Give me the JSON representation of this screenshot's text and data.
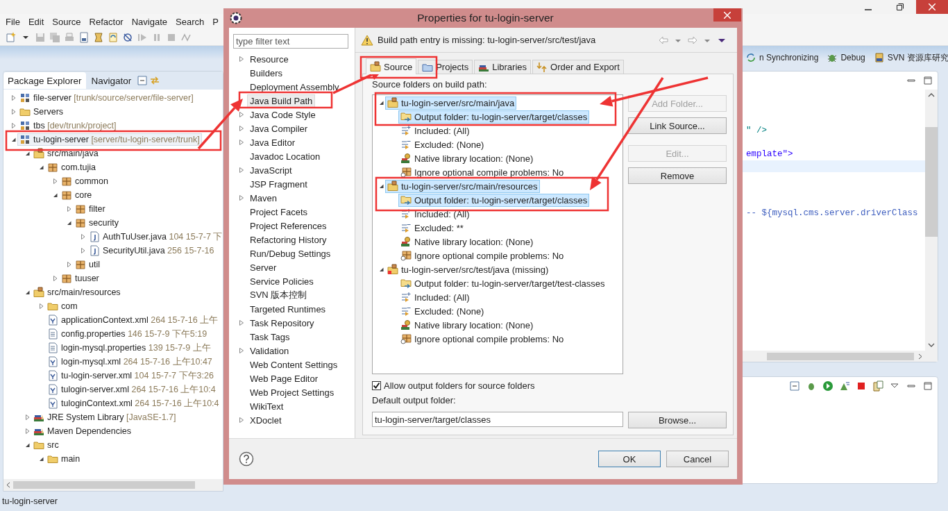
{
  "menu": [
    "File",
    "Edit",
    "Source",
    "Refactor",
    "Navigate",
    "Search",
    "P"
  ],
  "perspectives": [
    {
      "label": "n Synchronizing",
      "kind": "sync"
    },
    {
      "label": "Debug",
      "kind": "debug"
    },
    {
      "label": "SVN 资源库研究",
      "kind": "svn"
    }
  ],
  "views": [
    {
      "label": "Package Explorer",
      "selected": true
    },
    {
      "label": "Navigator",
      "selected": false
    }
  ],
  "package_tree": [
    {
      "label": "file-server",
      "decoration": "[trunk/source/server/file-server]",
      "kind": "project",
      "expanded": false,
      "selected": false
    },
    {
      "label": "Servers",
      "kind": "folder",
      "expanded": false,
      "selected": false
    },
    {
      "label": "tbs",
      "decoration": "[dev/trunk/project]",
      "kind": "project",
      "expanded": false,
      "selected": false
    },
    {
      "label": "tu-login-server",
      "decoration": "[server/tu-login-server/trunk]",
      "kind": "project",
      "expanded": true,
      "selected": true,
      "children": [
        {
          "label": "src/main/java",
          "kind": "source_folder",
          "expanded": true,
          "selected": false,
          "children": [
            {
              "label": "com.tujia",
              "kind": "package",
              "expanded": true,
              "selected": false,
              "children": [
                {
                  "label": "common",
                  "kind": "package",
                  "expanded": false,
                  "selected": false
                },
                {
                  "label": "core",
                  "kind": "package",
                  "expanded": true,
                  "selected": false,
                  "children": [
                    {
                      "label": "filter",
                      "kind": "package",
                      "expanded": false,
                      "selected": false
                    },
                    {
                      "label": "security",
                      "kind": "package",
                      "expanded": true,
                      "selected": false,
                      "children": [
                        {
                          "label": "AuthTuUser.java",
                          "decoration": "104  15-7-7 下",
                          "kind": "java",
                          "expanded": false,
                          "selected": false
                        },
                        {
                          "label": "SecurityUtil.java",
                          "decoration": "256  15-7-16",
                          "kind": "java",
                          "expanded": false,
                          "selected": false
                        }
                      ]
                    },
                    {
                      "label": "util",
                      "kind": "package",
                      "expanded": false,
                      "selected": false
                    }
                  ]
                },
                {
                  "label": "tuuser",
                  "kind": "package",
                  "expanded": false,
                  "selected": false
                }
              ]
            }
          ]
        },
        {
          "label": "src/main/resources",
          "kind": "source_folder",
          "expanded": true,
          "selected": false,
          "children": [
            {
              "label": "com",
              "kind": "folder",
              "expanded": false,
              "selected": false
            },
            {
              "label": "applicationContext.xml",
              "decoration": "264  15-7-16 上午",
              "kind": "xml",
              "selected": false
            },
            {
              "label": "config.properties",
              "decoration": "146  15-7-9 下午5:19",
              "kind": "properties",
              "selected": false
            },
            {
              "label": "login-mysql.properties",
              "decoration": "139  15-7-9 上午",
              "kind": "properties",
              "selected": false
            },
            {
              "label": "login-mysql.xml",
              "decoration": "264  15-7-16 上午10:47",
              "kind": "xml",
              "selected": false
            },
            {
              "label": "tu-login-server.xml",
              "decoration": "104  15-7-7 下午3:26",
              "kind": "xml",
              "selected": false
            },
            {
              "label": "tulogin-server.xml",
              "decoration": "264  15-7-16 上午10:4",
              "kind": "xml",
              "selected": false
            },
            {
              "label": "tuloginContext.xml",
              "decoration": "264  15-7-16 上午10:4",
              "kind": "xml",
              "selected": false
            }
          ]
        },
        {
          "label": "JRE System Library",
          "decoration": "[JavaSE-1.7]",
          "kind": "library",
          "expanded": false,
          "selected": false
        },
        {
          "label": "Maven Dependencies",
          "kind": "library",
          "expanded": false,
          "selected": false
        },
        {
          "label": "src",
          "kind": "folder",
          "expanded": true,
          "selected": false,
          "children": [
            {
              "label": "main",
              "kind": "folder",
              "expanded": true,
              "selected": false
            }
          ]
        }
      ]
    }
  ],
  "editor": {
    "lines": [
      {
        "current": false
      },
      {
        "current": false
      },
      {
        "current": false
      },
      {
        "text": "\" />",
        "kind": "tag",
        "current": false
      },
      {
        "current": false
      },
      {
        "text": "emplate\">",
        "kind": "string",
        "current": false
      },
      {
        "current": true
      },
      {
        "current": false
      },
      {
        "current": false
      },
      {
        "current": false
      },
      {
        "text": "-- ${mysql.cms.server.driverClass",
        "kind": "comment",
        "current": false
      }
    ]
  },
  "status_bar": "tu-login-server",
  "dialog": {
    "title": "Properties for tu-login-server",
    "filter": {
      "placeholder": "type filter text"
    },
    "pages": [
      {
        "label": "Resource",
        "kind": "group",
        "selected": false
      },
      {
        "label": "Builders",
        "kind": "page",
        "selected": false
      },
      {
        "label": "Deployment Assembly",
        "kind": "page",
        "selected": false
      },
      {
        "label": "Java Build Path",
        "kind": "page",
        "selected": true
      },
      {
        "label": "Java Code Style",
        "kind": "group",
        "selected": false
      },
      {
        "label": "Java Compiler",
        "kind": "group",
        "selected": false
      },
      {
        "label": "Java Editor",
        "kind": "group",
        "selected": false
      },
      {
        "label": "Javadoc Location",
        "kind": "page",
        "selected": false
      },
      {
        "label": "JavaScript",
        "kind": "group",
        "selected": false
      },
      {
        "label": "JSP Fragment",
        "kind": "page",
        "selected": false
      },
      {
        "label": "Maven",
        "kind": "group",
        "selected": false
      },
      {
        "label": "Project Facets",
        "kind": "page",
        "selected": false
      },
      {
        "label": "Project References",
        "kind": "page",
        "selected": false
      },
      {
        "label": "Refactoring History",
        "kind": "page",
        "selected": false
      },
      {
        "label": "Run/Debug Settings",
        "kind": "page",
        "selected": false
      },
      {
        "label": "Server",
        "kind": "page",
        "selected": false
      },
      {
        "label": "Service Policies",
        "kind": "page",
        "selected": false
      },
      {
        "label": "SVN 版本控制",
        "kind": "page",
        "selected": false
      },
      {
        "label": "Targeted Runtimes",
        "kind": "page",
        "selected": false
      },
      {
        "label": "Task Repository",
        "kind": "group",
        "selected": false
      },
      {
        "label": "Task Tags",
        "kind": "page",
        "selected": false
      },
      {
        "label": "Validation",
        "kind": "group",
        "selected": false
      },
      {
        "label": "Web Content Settings",
        "kind": "page",
        "selected": false
      },
      {
        "label": "Web Page Editor",
        "kind": "page",
        "selected": false
      },
      {
        "label": "Web Project Settings",
        "kind": "page",
        "selected": false
      },
      {
        "label": "WikiText",
        "kind": "page",
        "selected": false
      },
      {
        "label": "XDoclet",
        "kind": "group",
        "selected": false
      }
    ],
    "message": "Build path entry is missing: tu-login-server/src/test/java",
    "tabs": [
      {
        "label": "Source",
        "kind": "source",
        "selected": true
      },
      {
        "label": "Projects",
        "kind": "projects",
        "selected": false
      },
      {
        "label": "Libraries",
        "kind": "libraries",
        "selected": false
      },
      {
        "label": "Order and Export",
        "kind": "order",
        "selected": false
      }
    ],
    "source_label": "Source folders on build path:",
    "source_tree": [
      {
        "label": "tu-login-server/src/main/java",
        "kind": "source_folder",
        "expanded": true,
        "selected": true,
        "children": [
          {
            "label": "Output folder: tu-login-server/target/classes",
            "kind": "output",
            "selected": true
          },
          {
            "label": "Included: (All)",
            "kind": "included",
            "selected": false
          },
          {
            "label": "Excluded: (None)",
            "kind": "excluded",
            "selected": false
          },
          {
            "label": "Native library location: (None)",
            "kind": "native",
            "selected": false
          },
          {
            "label": "Ignore optional compile problems: No",
            "kind": "ignore",
            "selected": false
          }
        ]
      },
      {
        "label": "tu-login-server/src/main/resources",
        "kind": "source_folder",
        "expanded": true,
        "selected": true,
        "children": [
          {
            "label": "Output folder: tu-login-server/target/classes",
            "kind": "output",
            "selected": true
          },
          {
            "label": "Included: (All)",
            "kind": "included",
            "selected": false
          },
          {
            "label": "Excluded: **",
            "kind": "excluded",
            "selected": false
          },
          {
            "label": "Native library location: (None)",
            "kind": "native",
            "selected": false
          },
          {
            "label": "Ignore optional compile problems: No",
            "kind": "ignore",
            "selected": false
          }
        ]
      },
      {
        "label": "tu-login-server/src/test/java (missing)",
        "kind": "missing_folder",
        "expanded": true,
        "selected": false,
        "children": [
          {
            "label": "Output folder: tu-login-server/target/test-classes",
            "kind": "output",
            "selected": false
          },
          {
            "label": "Included: (All)",
            "kind": "included",
            "selected": false
          },
          {
            "label": "Excluded: (None)",
            "kind": "excluded",
            "selected": false
          },
          {
            "label": "Native library location: (None)",
            "kind": "native",
            "selected": false
          },
          {
            "label": "Ignore optional compile problems: No",
            "kind": "ignore",
            "selected": false
          }
        ]
      }
    ],
    "button_groups": [
      [
        {
          "label": "Add Folder...",
          "disabled": true
        },
        {
          "label": "Link Source...",
          "disabled": false
        }
      ],
      [
        {
          "label": "Edit...",
          "disabled": true
        },
        {
          "label": "Remove",
          "disabled": false
        }
      ]
    ],
    "allow_output": {
      "label": "Allow output folders for source folders",
      "checked": true
    },
    "default_output": {
      "label": "Default output folder:",
      "value": "tu-login-server/target/classes"
    },
    "browse": "Browse...",
    "ok": "OK",
    "cancel": "Cancel"
  }
}
